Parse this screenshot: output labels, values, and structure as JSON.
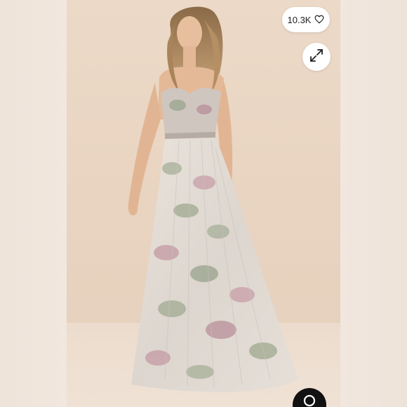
{
  "listing": {
    "likes_count": "10.3K",
    "like_icon": "heart-outline-icon",
    "expand_icon": "expand-arrows-icon",
    "search_icon": "search-icon"
  },
  "colors": {
    "pill_bg": "#ffffff",
    "search_button_bg": "#111111",
    "backdrop": "#ebd8c6"
  }
}
